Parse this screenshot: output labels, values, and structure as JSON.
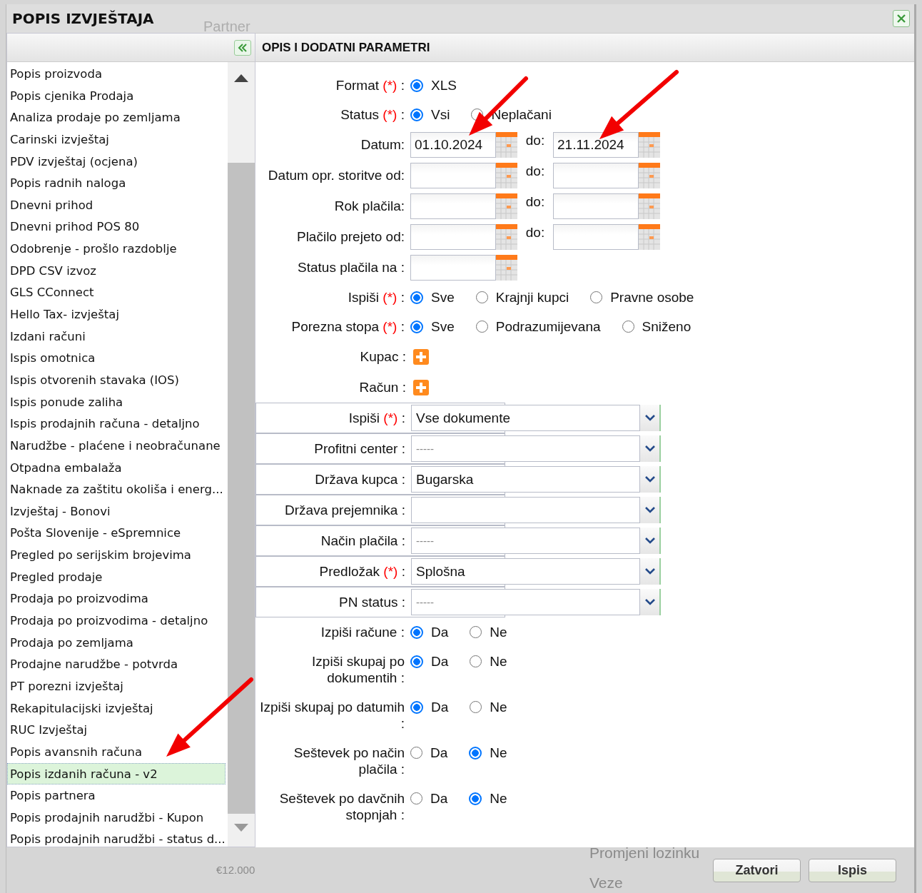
{
  "background_texts": [
    "Partner",
    "€12.000",
    "Promjeni lozinku",
    "Veze"
  ],
  "dialog": {
    "title": "POPIS IZVJEŠTAJA"
  },
  "report_list": {
    "items": [
      {
        "label": "Popis proizvoda",
        "selected": false
      },
      {
        "label": "Popis cjenika Prodaja",
        "selected": false
      },
      {
        "label": "Analiza prodaje po zemljama",
        "selected": false
      },
      {
        "label": "Carinski izvještaj",
        "selected": false
      },
      {
        "label": "PDV izvještaj (ocjena)",
        "selected": false
      },
      {
        "label": "Popis radnih naloga",
        "selected": false
      },
      {
        "label": "Dnevni prihod",
        "selected": false
      },
      {
        "label": "Dnevni prihod POS 80",
        "selected": false
      },
      {
        "label": "Odobrenje - prošlo razdoblje",
        "selected": false
      },
      {
        "label": "DPD CSV izvoz",
        "selected": false
      },
      {
        "label": "GLS CConnect",
        "selected": false
      },
      {
        "label": "Hello Tax- izvještaj",
        "selected": false
      },
      {
        "label": "Izdani računi",
        "selected": false
      },
      {
        "label": "Ispis omotnica",
        "selected": false
      },
      {
        "label": "Ispis otvorenih stavaka (IOS)",
        "selected": false
      },
      {
        "label": "Ispis ponude zaliha",
        "selected": false
      },
      {
        "label": "Ispis prodajnih računa - detaljno",
        "selected": false
      },
      {
        "label": "Narudžbe - plaćene i neobračunane",
        "selected": false
      },
      {
        "label": "Otpadna embalaža",
        "selected": false
      },
      {
        "label": "Naknade za zaštitu okoliša i energ...",
        "selected": false
      },
      {
        "label": "Izvještaj - Bonovi",
        "selected": false
      },
      {
        "label": "Pošta Slovenije - eSpremnice",
        "selected": false
      },
      {
        "label": "Pregled po serijskim brojevima",
        "selected": false
      },
      {
        "label": "Pregled prodaje",
        "selected": false
      },
      {
        "label": "Prodaja po proizvodima",
        "selected": false
      },
      {
        "label": "Prodaja po proizvodima - detaljno",
        "selected": false
      },
      {
        "label": "Prodaja po zemljama",
        "selected": false
      },
      {
        "label": "Prodajne narudžbe - potvrda",
        "selected": false
      },
      {
        "label": "PT porezni izvještaj",
        "selected": false
      },
      {
        "label": "Rekapitulacijski izvještaj",
        "selected": false
      },
      {
        "label": "RUC Izvještaj",
        "selected": false
      },
      {
        "label": "Popis avansnih računa",
        "selected": false
      },
      {
        "label": "Popis izdanih računa - v2",
        "selected": true
      },
      {
        "label": "Popis partnera",
        "selected": false
      },
      {
        "label": "Popis prodajnih narudžbi - Kupon",
        "selected": false
      },
      {
        "label": "Popis prodajnih narudžbi - status d...",
        "selected": false
      }
    ]
  },
  "panel": {
    "title": "OPIS I DODATNI PARAMETRI"
  },
  "fields": [
    {
      "kind": "radio",
      "label": "Format",
      "required_mark": "(*)",
      "suffix": ":",
      "options": [
        {
          "label": "XLS",
          "selected": true
        }
      ]
    },
    {
      "kind": "radio",
      "label": "Status",
      "required_mark": "(*)",
      "suffix": ":",
      "options": [
        {
          "label": "Vsi",
          "selected": true
        },
        {
          "label": "Neplačani",
          "selected": false
        }
      ]
    },
    {
      "kind": "daterange",
      "label": "Datum:",
      "from": "01.10.2024",
      "to_label": "do:",
      "to": "21.11.2024"
    },
    {
      "kind": "daterange",
      "label": "Datum opr. storitve od:",
      "to_label": "do:"
    },
    {
      "kind": "daterange",
      "label": "Rok plačila:",
      "to_label": "do:"
    },
    {
      "kind": "daterange",
      "label": "Plačilo prejeto od:",
      "to_label": "do:"
    },
    {
      "kind": "date",
      "label": "Status plačila na :"
    },
    {
      "kind": "radio",
      "label": "Ispiši",
      "required_mark": "(*)",
      "suffix": ":",
      "options": [
        {
          "label": "Sve",
          "selected": true
        },
        {
          "label": "Krajnji kupci",
          "selected": false
        },
        {
          "label": "Pravne osobe",
          "selected": false
        }
      ]
    },
    {
      "kind": "radio",
      "label": "Porezna stopa",
      "required_mark": "(*)",
      "suffix": ":",
      "options": [
        {
          "label": "Sve",
          "selected": true
        },
        {
          "label": "Podrazumijevana",
          "selected": false
        },
        {
          "label": "Sniženo",
          "selected": false
        }
      ]
    },
    {
      "kind": "add",
      "label": "Kupac :"
    },
    {
      "kind": "add",
      "label": "Račun :"
    },
    {
      "kind": "select",
      "label": "Ispiši",
      "required_mark": "(*)",
      "suffix": ":",
      "value": "Vse dokumente"
    },
    {
      "kind": "select",
      "label": "Profitni center :",
      "placeholder": "-----"
    },
    {
      "kind": "select",
      "label": "Država kupca :",
      "value": "Bugarska"
    },
    {
      "kind": "select",
      "label": "Država prejemnika :"
    },
    {
      "kind": "select",
      "label": "Način plačila :",
      "placeholder": "-----"
    },
    {
      "kind": "select",
      "label": "Predložak",
      "required_mark": "(*)",
      "suffix": ":",
      "value": "Splošna"
    },
    {
      "kind": "select",
      "label": "PN status :",
      "placeholder": "-----"
    },
    {
      "kind": "radio",
      "label": "Izpiši račune :",
      "options": [
        {
          "label": "Da",
          "selected": true
        },
        {
          "label": "Ne",
          "selected": false
        }
      ]
    },
    {
      "kind": "radio",
      "label": "Izpiši skupaj po dokumentih :",
      "options": [
        {
          "label": "Da",
          "selected": true
        },
        {
          "label": "Ne",
          "selected": false
        }
      ]
    },
    {
      "kind": "radio",
      "label": "Izpiši skupaj po datumih :",
      "options": [
        {
          "label": "Da",
          "selected": true
        },
        {
          "label": "Ne",
          "selected": false
        }
      ]
    },
    {
      "kind": "radio",
      "label": "Seštevek po način plačila :",
      "options": [
        {
          "label": "Da",
          "selected": false
        },
        {
          "label": "Ne",
          "selected": true
        }
      ]
    },
    {
      "kind": "radio",
      "label": "Seštevek po davčnih stopnjah :",
      "options": [
        {
          "label": "Da",
          "selected": false
        },
        {
          "label": "Ne",
          "selected": true
        }
      ]
    }
  ],
  "buttons": [
    "Zatvori",
    "Ispis"
  ]
}
